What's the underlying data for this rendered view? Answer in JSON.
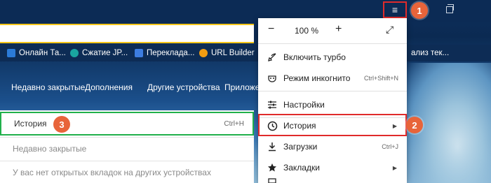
{
  "titlebar": {
    "menu_glyph": "≡",
    "badge1": "1"
  },
  "bookmarks": [
    {
      "label": "Онлайн Та...",
      "color": "#2b7bd8"
    },
    {
      "label": "Сжатие JP...",
      "color": "#1aa5a0"
    },
    {
      "label": "Переклада...",
      "color": "#3d7de0"
    },
    {
      "label": "URL Builder",
      "color": "#f29d12"
    },
    {
      "label": "ализ тек...",
      "color": "#0d2c55"
    }
  ],
  "nav": [
    "Недавно закрытые",
    "Дополнения",
    "Другие устройства",
    "Приложе"
  ],
  "history_panel": {
    "history_label": "История",
    "history_shortcut": "Ctrl+H",
    "badge3": "3",
    "recent_label": "Недавно закрытые",
    "no_tabs_label": "У вас нет открытых вкладок на других устройствах"
  },
  "menu": {
    "zoom_minus": "−",
    "zoom_value": "100 %",
    "zoom_plus": "+",
    "fullscreen_glyph": "⤢",
    "turbo": {
      "label": "Включить турбо",
      "icon": "rocket-icon"
    },
    "incognito": {
      "label": "Режим инкогнито",
      "shortcut": "Ctrl+Shift+N",
      "icon": "incognito-icon"
    },
    "settings": {
      "label": "Настройки",
      "icon": "sliders-icon"
    },
    "history": {
      "label": "История",
      "arrow": "▶",
      "icon": "clock-icon"
    },
    "downloads": {
      "label": "Загрузки",
      "shortcut": "Ctrl+J",
      "icon": "download-icon"
    },
    "bookmarks": {
      "label": "Закладки",
      "arrow": "▶",
      "icon": "star-icon"
    },
    "badge2": "2"
  }
}
